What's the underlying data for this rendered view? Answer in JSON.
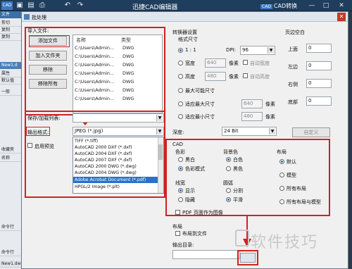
{
  "app": {
    "logo": "CAD",
    "title": "迅捷CAD编辑器",
    "convert_label": "CAD转换",
    "convert_mini": "CAD"
  },
  "left_panel": {
    "tab_file": "文件",
    "items": [
      "剪切",
      "复制",
      "复制"
    ],
    "doc_tab": "New1.d",
    "props": "属性",
    "default_val": "默认值",
    "general": "一般",
    "collect": "收藏夹",
    "name": "名称",
    "cmd1": "命令行",
    "cmd2": "命令行",
    "bottom": "New1.dwg"
  },
  "dialog": {
    "title": "批处理",
    "import_files_label": "导入文件:",
    "buttons": {
      "add_file": "添加文件",
      "add_folder": "加入文件夹",
      "remove": "移除",
      "remove_all": "移除所有"
    },
    "file_table": {
      "columns": [
        "名称",
        "类型"
      ],
      "rows": [
        [
          "C:\\Users\\Admin...",
          "DWG"
        ],
        [
          "C:\\Users\\Admin...",
          "DWG"
        ],
        [
          "C:\\Users\\Admin...",
          "DWG"
        ],
        [
          "C:\\Users\\Admin...",
          "DWG"
        ],
        [
          "C:\\Users\\Admin...",
          "DWG"
        ],
        [
          "C:\\Users\\Admin...",
          "DWG"
        ],
        [
          "C:\\Users\\Admin...",
          "DWG"
        ]
      ]
    },
    "save_load_label": "保存/加载列表:",
    "output_format_label": "输出格式:",
    "output_format_value": "JPEG (*.jpg)",
    "enable_preview_label": "启用预览",
    "format_options": [
      "TIFF (*.tiff)",
      "AutoCAD 2000 DXF (*.dxf)",
      "AutoCAD 2004 DXF (*.dxf)",
      "AutoCAD 2007 DXF (*.dxf)",
      "AutoCAD 2000 DWG (*.dwg)",
      "AutoCAD 2004 DWG (*.dwg)",
      "Adobe Acrobat Document (*.pdf)",
      "HPGL/2 Image (*.plt)"
    ],
    "selected_option_index": 6,
    "converter_settings": "转换器设置",
    "format_size": "格式尺寸",
    "ratio": "1 : 1",
    "dpi_label": "DPI:",
    "dpi_value": "96",
    "width_label": "宽度",
    "width_value": "640",
    "height_label": "高度",
    "height_value": "480",
    "pixels": "像素",
    "auto_width": "自动宽度",
    "auto_height": "自动高度",
    "max_size": "最大可能尺寸",
    "fit_max": "适应最大尺寸",
    "fit_min": "适应最小尺寸",
    "fit_max_value": "640",
    "fit_min_value": "480",
    "depth_label": "深度:",
    "depth_value": "24 Bit",
    "custom_button": "自定义",
    "margins": {
      "title": "页边空白",
      "top": "上面",
      "left": "左边",
      "right": "右侧",
      "bottom": "底部",
      "value": "0"
    },
    "cad": {
      "title": "CAD",
      "color_title": "色彩",
      "color_bw": "黑白",
      "color_mode": "色彩模式",
      "bg_title": "背景色",
      "bg_white": "白色",
      "bg_black": "黑色",
      "layout_title": "布局",
      "layout_default": "默认",
      "layout_model": "模型",
      "layout_all": "所有布局",
      "layout_all_model": "所有布局与模型",
      "linewidth_title": "线宽",
      "lw_show": "显示",
      "lw_hide": "隐藏",
      "arc_title": "圆弧",
      "arc_split": "分割",
      "arc_smooth": "平滑"
    },
    "pdf_page_as_image": "PDF 页面作为图像",
    "layout_section": "布局",
    "layout_to_file": "布局到文件",
    "output_dir": "输出目录:"
  },
  "watermark": "软件技巧",
  "colors": {
    "highlight_red": "#d42020",
    "selection_blue": "#2a72c8",
    "titlebar": "#1f3d5c"
  }
}
